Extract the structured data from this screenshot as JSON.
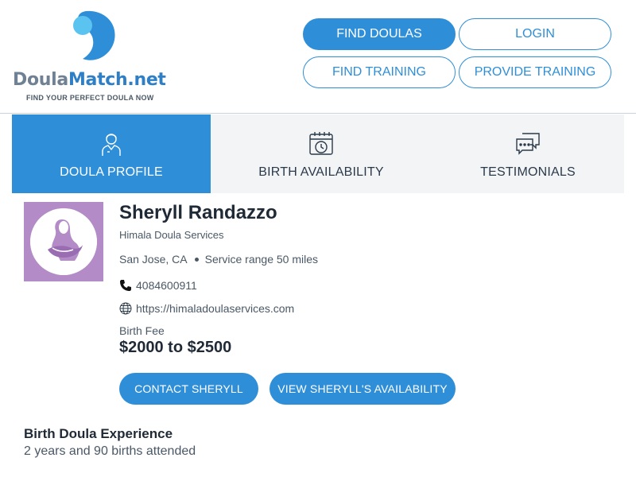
{
  "logo": {
    "name_part1": "Doula",
    "name_part2": "Match.net",
    "tagline": "FIND YOUR PERFECT DOULA NOW",
    "brand_color": "#2e8fd8"
  },
  "nav": {
    "find_doulas": "FIND DOULAS",
    "login": "LOGIN",
    "find_training": "FIND TRAINING",
    "provide_training": "PROVIDE TRAINING"
  },
  "tabs": [
    {
      "label": "DOULA PROFILE",
      "icon": "person-icon",
      "active": true
    },
    {
      "label": "BIRTH AVAILABILITY",
      "icon": "calendar-clock-icon",
      "active": false
    },
    {
      "label": "TESTIMONIALS",
      "icon": "chat-bubbles-icon",
      "active": false
    }
  ],
  "profile": {
    "name": "Sheryll Randazzo",
    "company": "Himala Doula Services",
    "city": "San Jose, CA",
    "service_range": "Service range 50 miles",
    "phone": "4084600911",
    "website": "https://himaladoulaservices.com",
    "fee_label": "Birth Fee",
    "fee_value": "$2000 to $2500",
    "avatar_bg": "#b28bc7"
  },
  "actions": {
    "contact": "CONTACT SHERYLL",
    "availability": "VIEW SHERYLL'S AVAILABILITY"
  },
  "experience": {
    "title": "Birth Doula Experience",
    "text": "2 years and 90 births attended"
  }
}
